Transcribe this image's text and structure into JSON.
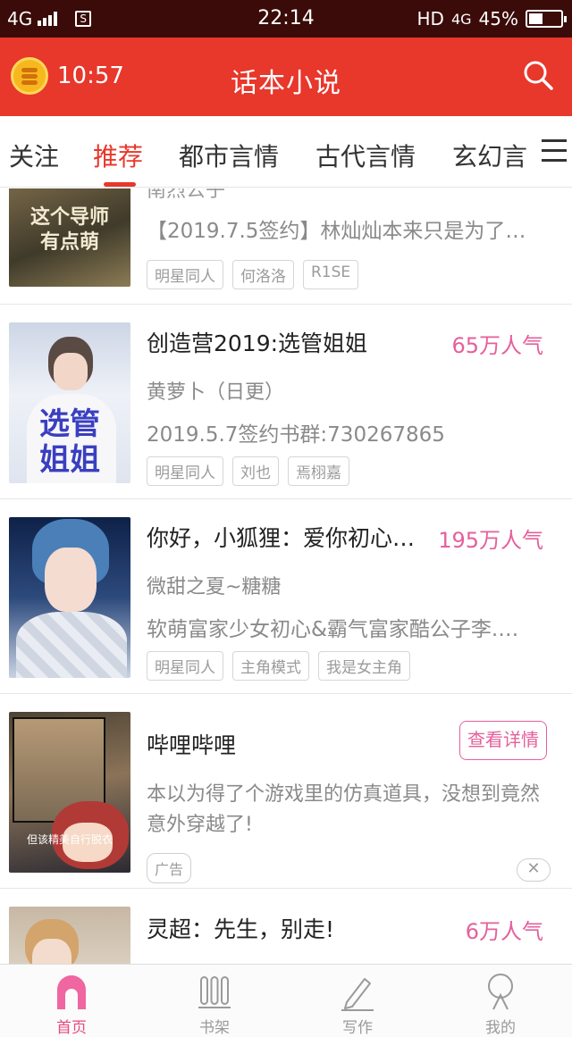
{
  "status_bar": {
    "network": "4G",
    "sim_badge": "S",
    "time": "22:14",
    "hd": "HD",
    "net2": "4G",
    "battery": "45%",
    "battery_level": 0.45
  },
  "header": {
    "timer": "10:57",
    "title": "话本小说"
  },
  "tabs": [
    "关注",
    "推荐",
    "都市言情",
    "古代言情",
    "玄幻言情"
  ],
  "active_tab": "推荐",
  "books": [
    {
      "cover_text": [
        "这个导师",
        "有点萌"
      ],
      "author": "南烈公子",
      "description": "【2019.7.5签约】林灿灿本来只是为了…",
      "tags": [
        "明星同人",
        "何洛洛",
        "R1SE"
      ]
    },
    {
      "cover_text": [
        "选管",
        "姐姐"
      ],
      "title": "创造营2019:选管姐姐",
      "popularity": "65万人气",
      "author": "黄萝卜（日更）",
      "description": "2019.5.7签约书群:730267865",
      "tags": [
        "明星同人",
        "刘也",
        "焉栩嘉"
      ]
    },
    {
      "title": "你好，小狐狸：爱你初心…",
      "popularity": "195万人气",
      "author": "微甜之夏~糖糖",
      "description": "软萌富家少女初心&霸气富家酷公子李.…",
      "tags": [
        "明星同人",
        "主角模式",
        "我是女主角"
      ]
    }
  ],
  "ad": {
    "cover_text": "但该精美自行脱衣",
    "title": "哔哩哔哩",
    "button": "查看详情",
    "description": "本以为得了个游戏里的仿真道具，没想到竟然意外穿越了!",
    "badge": "广告",
    "close": "✕"
  },
  "last_book": {
    "title": "灵超：先生，别走!",
    "popularity": "6万人气"
  },
  "bottom_nav": [
    {
      "label": "首页",
      "icon": "home-icon"
    },
    {
      "label": "书架",
      "icon": "bookshelf-icon"
    },
    {
      "label": "写作",
      "icon": "pen-icon"
    },
    {
      "label": "我的",
      "icon": "profile-icon"
    }
  ],
  "colors": {
    "header_red": "#e8372b",
    "popularity_pink": "#e5609c",
    "status_bar": "#3a0b08"
  }
}
